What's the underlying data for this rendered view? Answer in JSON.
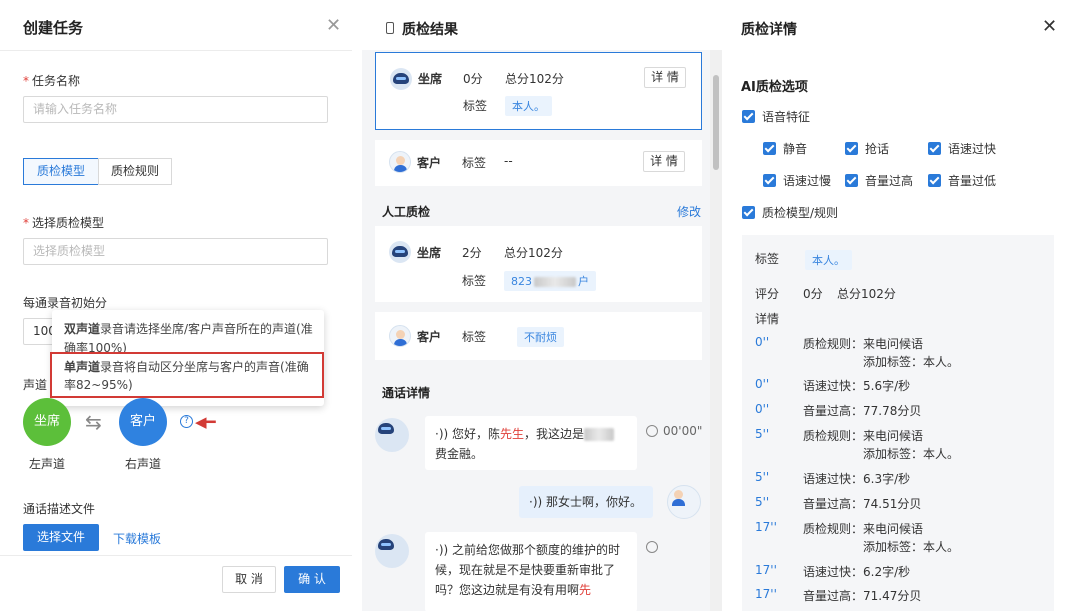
{
  "create_task": {
    "title": "创建任务",
    "task_name_label": "任务名称",
    "task_name_placeholder": "请输入任务名称",
    "tabs": [
      "质检模型",
      "质检规则"
    ],
    "model_label": "选择质检模型",
    "model_placeholder": "选择质检模型",
    "initial_score_label": "每通录音初始分",
    "initial_score_value": "100",
    "channel_label": "声道",
    "agent_circle": "坐席",
    "customer_circle": "客户",
    "left_channel": "左声道",
    "right_channel": "右声道",
    "desc_file_label": "通话描述文件",
    "choose_file": "选择文件",
    "download_template": "下载模板",
    "cancel": "取 消",
    "confirm": "确 认",
    "tooltip": {
      "dual_title": "双声道",
      "dual_text": "录音请选择坐席/客户声音所在的声道(准确率100%)",
      "mono_title": "单声道",
      "mono_text": "录音将自动区分坐席与客户的声音(准确率82~95%)"
    }
  },
  "qc_result": {
    "title": "质检结果",
    "agent": "坐席",
    "customer": "客户",
    "score": "0分",
    "total": "总分102分",
    "tag_label": "标签",
    "tag_value": "本人。",
    "detail_btn": "详 情",
    "customer_tag_value": "--",
    "manual_title": "人工质检",
    "edit": "修改",
    "manual_score": "2分",
    "manual_tag_prefix": "823",
    "manual_tag_suffix": "户",
    "manual_customer_tag": "不耐烦",
    "call_detail_title": "通话详情",
    "msg1_a": "您好，陈",
    "msg1_highlight": "先生",
    "msg1_b": "，我这边是",
    "msg1_c": "费金融。",
    "msg1_time": "00'00\"",
    "msg2": "那女士啊，你好。",
    "msg3_a": "之前给您做那个额度的维护的时候，现在就是不是快要重新审批了吗？您这边就是有没有用啊",
    "msg3_highlight": "先"
  },
  "qc_detail": {
    "title": "质检详情",
    "ai_options_title": "AI质检选项",
    "speech_features": "语音特征",
    "features": [
      "静音",
      "抢话",
      "语速过快",
      "语速过慢",
      "音量过高",
      "音量过低"
    ],
    "model_rules": "质检模型/规则",
    "tag_label": "标签",
    "tag_value": "本人。",
    "score_label": "评分",
    "score_value": "0分",
    "score_total": "总分102分",
    "detail_label": "详情",
    "rows": [
      {
        "time": "0''",
        "a": "质检规则：来电问候语",
        "b": "添加标签：本人。"
      },
      {
        "time": "0''",
        "a": "语速过快：5.6字/秒",
        "b": ""
      },
      {
        "time": "0''",
        "a": "音量过高：77.78分贝",
        "b": ""
      },
      {
        "time": "5''",
        "a": "质检规则：来电问候语",
        "b": "添加标签：本人。"
      },
      {
        "time": "5''",
        "a": "语速过快：6.3字/秒",
        "b": ""
      },
      {
        "time": "5''",
        "a": "音量过高：74.51分贝",
        "b": ""
      },
      {
        "time": "17''",
        "a": "质检规则：来电问候语",
        "b": "添加标签：本人。"
      },
      {
        "time": "17''",
        "a": "语速过快：6.2字/秒",
        "b": ""
      },
      {
        "time": "17''",
        "a": "音量过高：71.47分贝",
        "b": ""
      }
    ]
  }
}
